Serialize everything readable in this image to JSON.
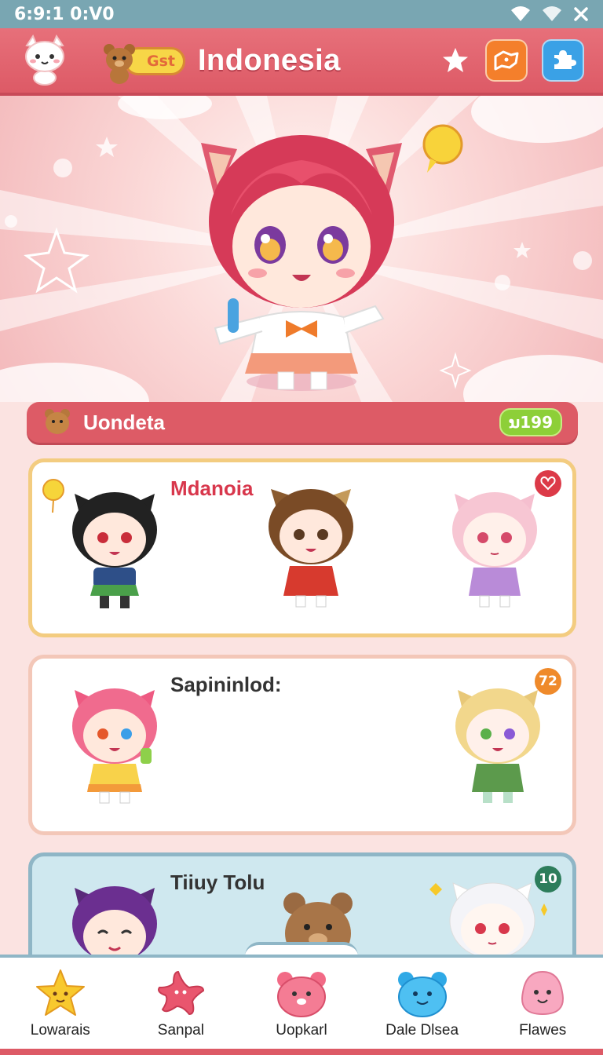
{
  "status_bar": {
    "time": "6:9:1 0:V0",
    "icons": [
      "wifi-icon",
      "wifi-icon",
      "close-icon"
    ]
  },
  "header": {
    "title": "Indonesia",
    "badge_label": "Gst",
    "icons": [
      "cat-avatar-icon",
      "bear-icon",
      "star-icon",
      "map-icon",
      "puzzle-icon"
    ]
  },
  "section": {
    "title": "Uondeta",
    "badge": "ນ199"
  },
  "cards": [
    {
      "title": "Mdanoia",
      "badge_icon": "heart-icon",
      "theme": "#f3cc80"
    },
    {
      "title": "Sapininlod:",
      "badge": "72",
      "theme": "#f3c7b8"
    },
    {
      "title": "Tiiuy Tolu",
      "badge": "10",
      "theme": "#8fb6c6"
    }
  ],
  "nav": {
    "items": [
      {
        "label": "Lowarais",
        "icon": "star-icon"
      },
      {
        "label": "Sanpal",
        "icon": "starfish-icon"
      },
      {
        "label": "Uopkarl",
        "icon": "bear-face-icon"
      },
      {
        "label": "Dale Dlsea",
        "icon": "bear-face-blue-icon"
      },
      {
        "label": "Flawes",
        "icon": "slime-icon"
      }
    ]
  },
  "colors": {
    "header": "#dd5a66",
    "section": "#dd5b66",
    "badge_green": "#8dcf38",
    "status_bar": "#79a6b2"
  }
}
